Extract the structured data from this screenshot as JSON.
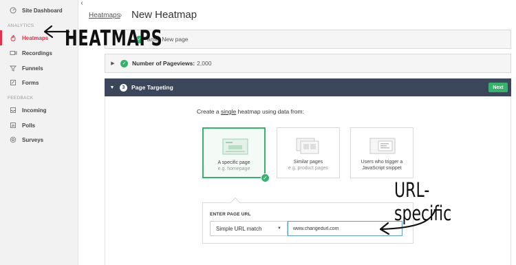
{
  "sidebar": {
    "collapse_glyph": "‹",
    "top_item": {
      "label": "Site Dashboard",
      "icon": "dashboard-icon"
    },
    "sections": [
      {
        "title": "ANALYTICS"
      },
      {
        "title": "FEEDBACK"
      }
    ],
    "items": [
      {
        "label": "Heatmaps",
        "icon": "flame-icon",
        "active": true
      },
      {
        "label": "Recordings",
        "icon": "video-icon"
      },
      {
        "label": "Funnels",
        "icon": "funnel-icon"
      },
      {
        "label": "Forms",
        "icon": "form-icon"
      },
      {
        "label": "Incoming",
        "icon": "inbox-icon"
      },
      {
        "label": "Polls",
        "icon": "poll-icon"
      },
      {
        "label": "Surveys",
        "icon": "survey-icon"
      }
    ]
  },
  "header": {
    "breadcrumb": "Heatmaps",
    "title": "New Heatmap"
  },
  "steps": {
    "step1": {
      "label_visible": "ame: New page"
    },
    "step2": {
      "label": "Number of Pageviews:",
      "value": "2,000"
    },
    "step3": {
      "number": "3",
      "label": "Page Targeting",
      "next_label": "Next"
    }
  },
  "targeting": {
    "prompt_pre": "Create a ",
    "prompt_emph": "single",
    "prompt_post": " heatmap using data from:",
    "cards": [
      {
        "title": "A specific page",
        "subtitle": "e.g. homepage",
        "selected": true
      },
      {
        "title": "Similar pages",
        "subtitle": "e.g. product pages",
        "selected": false
      },
      {
        "title": "Users who trigger a",
        "subtitle": "JavaScript snippet",
        "selected": false
      }
    ],
    "url": {
      "label": "ENTER PAGE URL",
      "match_type": "Simple URL match",
      "value": "www.changedurl.com"
    }
  },
  "annotations": {
    "heatmaps": "HEATMAPS",
    "url_specific": "URL-specific"
  },
  "colors": {
    "accent_red": "#e0324b",
    "success_green": "#35b36b",
    "header_dark": "#3b465a",
    "input_focus_blue": "#5b9dd9"
  }
}
